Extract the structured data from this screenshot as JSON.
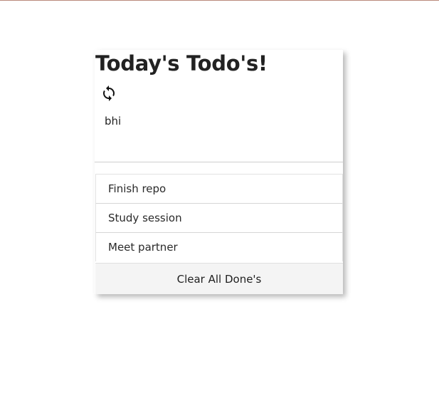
{
  "header": {
    "title": "Today's Todo's!",
    "refresh_icon": "refresh-icon"
  },
  "input": {
    "value": "bhi",
    "placeholder": ""
  },
  "todos": [
    {
      "label": "Finish repo"
    },
    {
      "label": "Study session"
    },
    {
      "label": "Meet partner"
    }
  ],
  "actions": {
    "clear_label": "Clear All Done's"
  },
  "colors": {
    "top_rule": "#b98a7c",
    "button_bg": "#f4f4f4",
    "text": "#222222"
  }
}
